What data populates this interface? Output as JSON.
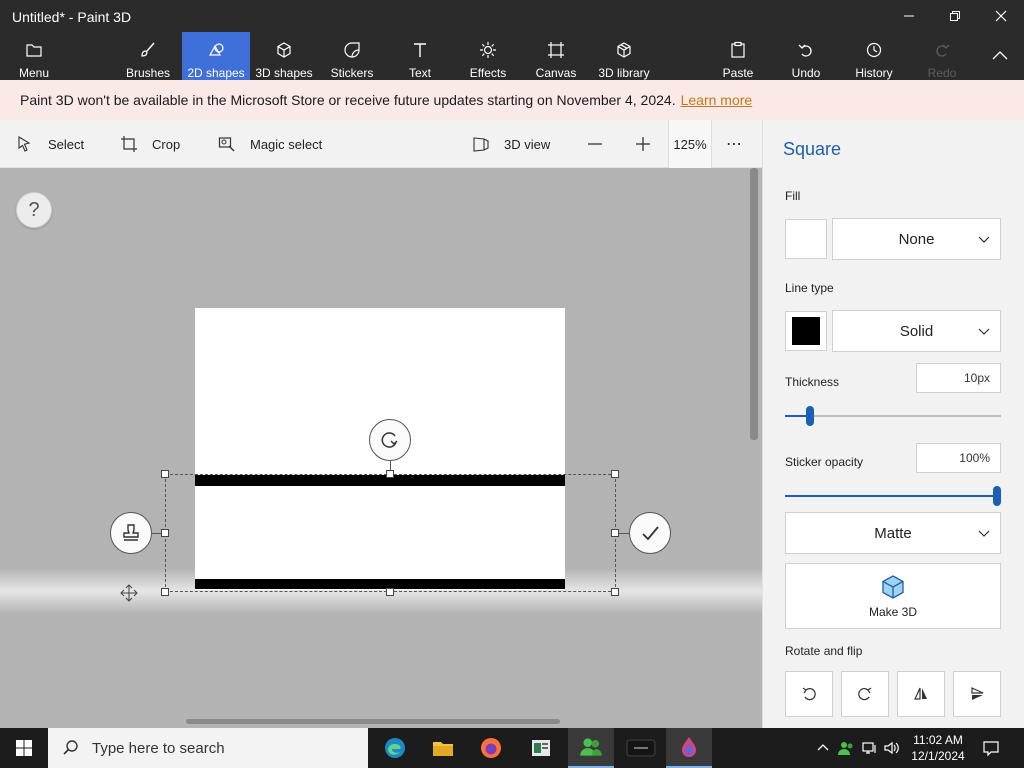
{
  "window": {
    "title": "Untitled* - Paint 3D"
  },
  "ribbon": {
    "menu": "Menu",
    "brushes": "Brushes",
    "shapes2d": "2D shapes",
    "shapes3d": "3D shapes",
    "stickers": "Stickers",
    "text": "Text",
    "effects": "Effects",
    "canvas": "Canvas",
    "library3d": "3D library",
    "paste": "Paste",
    "undo": "Undo",
    "history": "History",
    "redo": "Redo",
    "active_tab": "2D shapes",
    "accent_color": "#3f6fd9"
  },
  "notice": {
    "message": "Paint 3D won't be available in the Microsoft Store or receive future updates starting on November 4, 2024.",
    "link": "Learn more"
  },
  "toolbar": {
    "select": "Select",
    "crop": "Crop",
    "magic_select": "Magic select",
    "view3d": "3D view",
    "zoom": "125%",
    "more": "⋯"
  },
  "canvas": {
    "help": "?"
  },
  "panel": {
    "title": "Square",
    "fill_label": "Fill",
    "fill_value": "None",
    "fill_color": "#ffffff",
    "line_type_label": "Line type",
    "line_type_value": "Solid",
    "line_color": "#000000",
    "thickness_label": "Thickness",
    "thickness_value": "10px",
    "thickness_fraction": 0.1,
    "opacity_label": "Sticker opacity",
    "opacity_value": "100%",
    "opacity_fraction": 1.0,
    "finish_value": "Matte",
    "make3d_label": "Make 3D",
    "rotate_flip_label": "Rotate and flip"
  },
  "taskbar": {
    "search_placeholder": "Type here to search",
    "time": "11:02 AM",
    "date": "12/1/2024"
  }
}
